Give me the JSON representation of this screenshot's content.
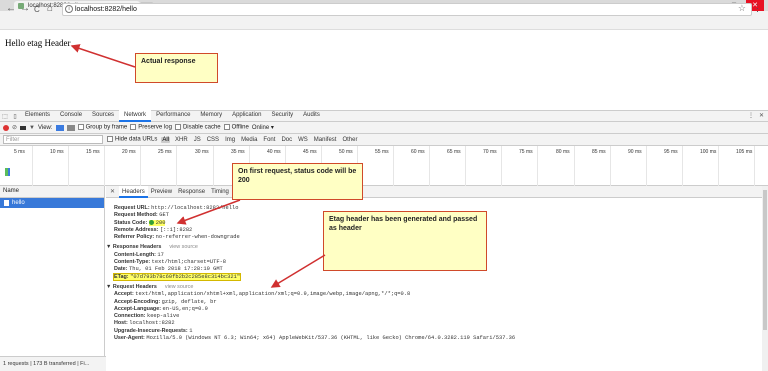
{
  "browser": {
    "tab_title": "localhost:8282/hello",
    "url": "localhost:8282/hello",
    "back": "←",
    "forward": "→",
    "reload": "C",
    "home": "⌂",
    "star": "☆",
    "menu": "⋮",
    "win_min": "—",
    "win_max": "□",
    "win_close": "✕"
  },
  "page": {
    "body_text": "Hello etag Header"
  },
  "callouts": {
    "actual_response": "Actual response",
    "first_request": "On first request, status code will be 200",
    "etag_generated": "Etag header has been generated and passed as header"
  },
  "devtools": {
    "panels": [
      "Elements",
      "Console",
      "Sources",
      "Network",
      "Performance",
      "Memory",
      "Application",
      "Security",
      "Audits"
    ],
    "active_panel": "Network",
    "toolbar": {
      "view_label": "View:",
      "group_by_frame": "Group by frame",
      "preserve_log": "Preserve log",
      "disable_cache": "Disable cache",
      "offline": "Offline",
      "throttle": "Online"
    },
    "filter": {
      "placeholder": "Filter",
      "hide_data_urls": "Hide data URLs",
      "types": [
        "All",
        "XHR",
        "JS",
        "CSS",
        "Img",
        "Media",
        "Font",
        "Doc",
        "WS",
        "Manifest",
        "Other"
      ]
    },
    "timeline_ticks": [
      "5 ms",
      "10 ms",
      "15 ms",
      "20 ms",
      "25 ms",
      "30 ms",
      "35 ms",
      "40 ms",
      "45 ms",
      "50 ms",
      "55 ms",
      "60 ms",
      "65 ms",
      "70 ms",
      "75 ms",
      "80 ms",
      "85 ms",
      "90 ms",
      "95 ms",
      "100 ms",
      "105 ms"
    ],
    "name_header": "Name",
    "request_name": "hello",
    "detail_tabs": [
      "Headers",
      "Preview",
      "Response",
      "Timing"
    ],
    "general": {
      "request_url_k": "Request URL:",
      "request_url_v": "http://localhost:8282/hello",
      "request_method_k": "Request Method:",
      "request_method_v": "GET",
      "status_code_k": "Status Code:",
      "status_code_v": "200",
      "remote_address_k": "Remote Address:",
      "remote_address_v": "[::1]:8282",
      "referrer_policy_k": "Referrer Policy:",
      "referrer_policy_v": "no-referrer-when-downgrade"
    },
    "response_headers": {
      "title": "Response Headers",
      "view_source": "view source",
      "content_length_k": "Content-Length:",
      "content_length_v": "17",
      "content_type_k": "Content-Type:",
      "content_type_v": "text/html;charset=UTF-8",
      "date_k": "Date:",
      "date_v": "Thu, 01 Feb 2018 17:28:10 GMT",
      "etag_k": "ETag:",
      "etag_v": "\"07d793b78c60fb2b2c285e8c314bc321\""
    },
    "request_headers": {
      "title": "Request Headers",
      "view_source": "view source",
      "accept_k": "Accept:",
      "accept_v": "text/html,application/xhtml+xml,application/xml;q=0.9,image/webp,image/apng,*/*;q=0.8",
      "accept_encoding_k": "Accept-Encoding:",
      "accept_encoding_v": "gzip, deflate, br",
      "accept_language_k": "Accept-Language:",
      "accept_language_v": "en-US,en;q=0.9",
      "connection_k": "Connection:",
      "connection_v": "keep-alive",
      "host_k": "Host:",
      "host_v": "localhost:8282",
      "upgrade_k": "Upgrade-Insecure-Requests:",
      "upgrade_v": "1",
      "user_agent_k": "User-Agent:",
      "user_agent_v": "Mozilla/5.0 (Windows NT 6.3; Win64; x64) AppleWebKit/537.36 (KHTML, like Gecko) Chrome/64.0.3282.119 Safari/537.36"
    },
    "status_bar": "1 requests | 173 B transferred | Fi..."
  },
  "colors": {
    "callout_bg": "#ffffc4",
    "arrow": "#d03030",
    "accent": "#1a73e8",
    "highlight": "#ffff66"
  }
}
